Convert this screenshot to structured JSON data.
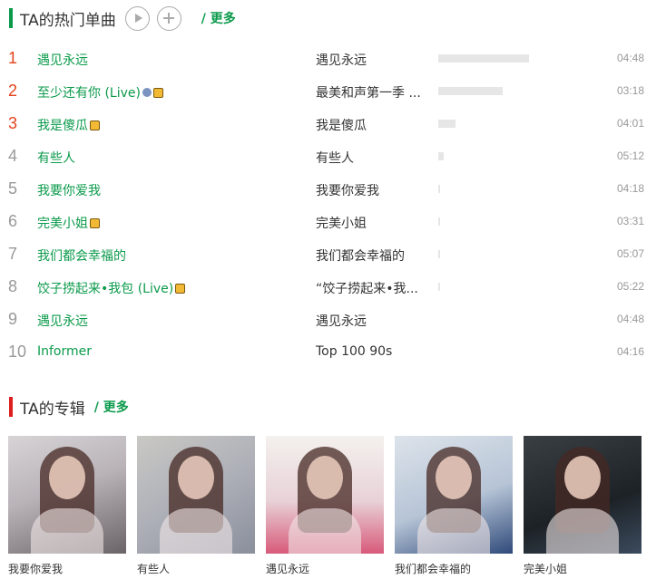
{
  "hot_songs": {
    "title": "TA的热门单曲",
    "more": "/ 更多",
    "songs": [
      {
        "rank": "1",
        "name": "遇见永远",
        "album": "遇见永远",
        "duration": "04:48",
        "popularity": 1.0,
        "top": true
      },
      {
        "rank": "2",
        "name": "至少还有你 (Live)",
        "album": "最美和声第一季 ...",
        "duration": "03:18",
        "popularity": 0.71,
        "top": true,
        "badges": [
          "live-icon",
          "vip-icon"
        ]
      },
      {
        "rank": "3",
        "name": "我是傻瓜",
        "album": "我是傻瓜",
        "duration": "04:01",
        "popularity": 0.19,
        "top": true,
        "badges": [
          "vip-icon"
        ]
      },
      {
        "rank": "4",
        "name": "有些人",
        "album": "有些人",
        "duration": "05:12",
        "popularity": 0.06
      },
      {
        "rank": "5",
        "name": "我要你爱我",
        "album": "我要你爱我",
        "duration": "04:18",
        "popularity": 0.02
      },
      {
        "rank": "6",
        "name": "完美小姐",
        "album": "完美小姐",
        "duration": "03:31",
        "popularity": 0.02,
        "badges": [
          "vip-icon"
        ]
      },
      {
        "rank": "7",
        "name": "我们都会幸福的",
        "album": "我们都会幸福的",
        "duration": "05:07",
        "popularity": 0.02
      },
      {
        "rank": "8",
        "name": "饺子捞起来•我包 (Live)",
        "album": "“饺子捞起来•我...",
        "duration": "05:22",
        "popularity": 0.02,
        "badges": [
          "vip-icon"
        ]
      },
      {
        "rank": "9",
        "name": "遇见永远",
        "album": "遇见永远",
        "duration": "04:48",
        "popularity": 0.0
      },
      {
        "rank": "10",
        "name": "Informer",
        "album": "Top 100 90s",
        "duration": "04:16",
        "popularity": 0.0
      }
    ]
  },
  "albums_section": {
    "title": "TA的专辑",
    "more": "/ 更多",
    "albums": [
      {
        "name": "我要你爱我",
        "cover_text": "我要你爱我"
      },
      {
        "name": "有些人",
        "cover_text": "有些人"
      },
      {
        "name": "遇见永远",
        "cover_text": "遇见永远"
      },
      {
        "name": "我们都会幸福的",
        "cover_text": "我们都会幸福的"
      },
      {
        "name": "完美小姐",
        "cover_text": "完美小姐"
      }
    ]
  },
  "colors": {
    "accent_green": "#0b9a4b",
    "accent_red": "#e5431c",
    "section_red": "#dd1e1e"
  }
}
